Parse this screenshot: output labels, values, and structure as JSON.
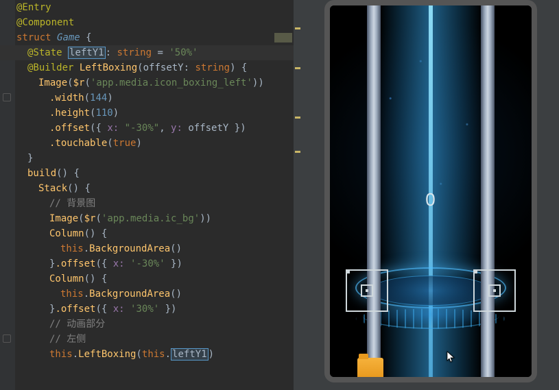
{
  "code": {
    "decorators": {
      "entry": "@Entry",
      "component": "@Component"
    },
    "struct_kw": "struct",
    "struct_name": "Game",
    "state": {
      "decorator": "@State",
      "name": "leftY1",
      "colon": ":",
      "type": "string",
      "eq": "=",
      "value": "'50%'"
    },
    "builder": {
      "decorator": "@Builder",
      "name": "LeftBoxing",
      "param": "offsetY",
      "param_type": "string"
    },
    "image_call": "Image",
    "r_fn": "$r",
    "icon_res": "'app.media.icon_boxing_left'",
    "bg_res": "'app.media.ic_bg'",
    "width_m": ".width",
    "width_v": "144",
    "height_m": ".height",
    "height_v": "110",
    "offset_m": ".offset",
    "offset_x_key": "x:",
    "offset_x_val": "\"-30%\"",
    "offset_y_key": "y:",
    "offset_y_val": "offsetY",
    "touchable_m": ".touchable",
    "touchable_v": "true",
    "build_fn": "build",
    "stack_fn": "Stack",
    "column_fn": "Column",
    "bg_area": "BackgroundArea",
    "offset_neg30": "'-30%'",
    "offset_pos30": "'30%'",
    "comment_bg": "// 背景图",
    "comment_anim": "// 动画部分",
    "comment_left": "// 左侧",
    "this_kw": "this",
    "leftboxing_call": "LeftBoxing",
    "lefty1_ref": "leftY1"
  },
  "preview": {
    "score": "0"
  }
}
